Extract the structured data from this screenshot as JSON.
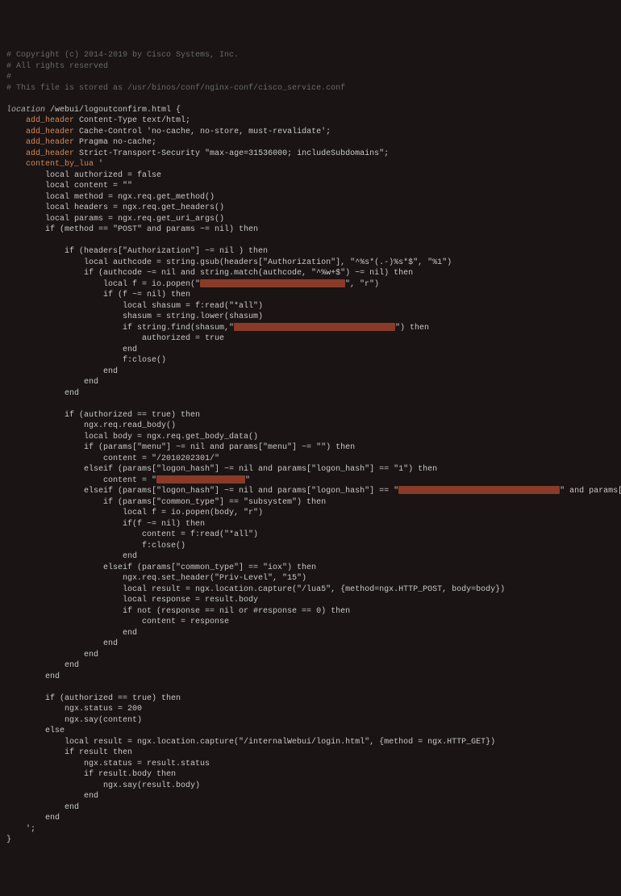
{
  "comments": {
    "c1": "# Copyright (c) 2014-2019 by Cisco Systems, Inc.",
    "c2": "# All rights reserved",
    "c3": "#",
    "c4": "# This file is stored as /usr/binos/conf/nginx-conf/cisco_service.conf"
  },
  "loc": {
    "kw": "location",
    "path": " /webui/logoutconfirm.html {",
    "add_header": "add_header",
    "h1": " Content-Type text/html;",
    "h2": " Cache-Control 'no-cache, no-store, must-revalidate';",
    "h3": " Pragma no-cache;",
    "h4": " Strict-Transport-Security \"max-age=31536000; includeSubdomains\";",
    "cbl": "content_by_lua",
    "cbl_open": " '"
  },
  "lua": {
    "l01": "        local authorized = false",
    "l02": "        local content = \"\"",
    "l03": "        local method = ngx.req.get_method()",
    "l04": "        local headers = ngx.req.get_headers()",
    "l05": "        local params = ngx.req.get_uri_args()",
    "l06": "        if (method == \"POST\" and params ~= nil) then",
    "l07": "",
    "l08": "            if (headers[\"Authorization\"] ~= nil ) then",
    "l09": "                local authcode = string.gsub(headers[\"Authorization\"], \"^%s*(.-)%s*$\", \"%1\")",
    "l10a": "                if (authcode ~= nil and string.match(authcode, \"^%w+$\") ~= nil) then",
    "l11a": "                    local f = io.popen(\"",
    "l11b": "\", \"r\")",
    "l12": "                    if (f ~= nil) then",
    "l13": "                        local shasum = f:read(\"*all\")",
    "l14": "                        shasum = string.lower(shasum)",
    "l15a": "                        if string.find(shasum,\"",
    "l15b": "\") then",
    "l16": "                            authorized = true",
    "l17": "                        end",
    "l18": "                        f:close()",
    "l19": "                    end",
    "l20": "                end",
    "l21": "            end",
    "l22": "",
    "l23": "            if (authorized == true) then",
    "l24": "                ngx.req.read_body()",
    "l25": "                local body = ngx.req.get_body_data()",
    "l26": "                if (params[\"menu\"] ~= nil and params[\"menu\"] ~= \"\") then",
    "l27": "                    content = \"/2010202301/\"",
    "l28": "                elseif (params[\"logon_hash\"] ~= nil and params[\"logon_hash\"] == \"1\") then",
    "l29a": "                    content = \"",
    "l29b": "\"",
    "l30a": "                elseif (params[\"logon_hash\"] ~= nil and params[\"logon_hash\"] == \"",
    "l30b": "\" and params[\"common_type\"] ~= nil) then",
    "l31": "                    if (params[\"common_type\"] == \"subsystem\") then",
    "l32": "                        local f = io.popen(body, \"r\")",
    "l33": "                        if(f ~= nil) then",
    "l34": "                            content = f:read(\"*all\")",
    "l35": "                            f:close()",
    "l36": "                        end",
    "l37": "                    elseif (params[\"common_type\"] == \"iox\") then",
    "l38": "                        ngx.req.set_header(\"Priv-Level\", \"15\")",
    "l39": "                        local result = ngx.location.capture(\"/lua5\", {method=ngx.HTTP_POST, body=body})",
    "l40": "                        local response = result.body",
    "l41": "                        if not (response == nil or #response == 0) then",
    "l42": "                            content = response",
    "l43": "                        end",
    "l44": "                    end",
    "l45": "                end",
    "l46": "            end",
    "l47": "        end",
    "l48": "",
    "l49": "        if (authorized == true) then",
    "l50": "            ngx.status = 200",
    "l51": "            ngx.say(content)",
    "l52": "        else",
    "l53": "            local result = ngx.location.capture(\"/internalWebui/login.html\", {method = ngx.HTTP_GET})",
    "l54": "            if result then",
    "l55": "                ngx.status = result.status",
    "l56": "                if result.body then",
    "l57": "                    ngx.say(result.body)",
    "l58": "                end",
    "l59": "            end",
    "l60": "        end",
    "l61": "    ';"
  },
  "close": "}"
}
